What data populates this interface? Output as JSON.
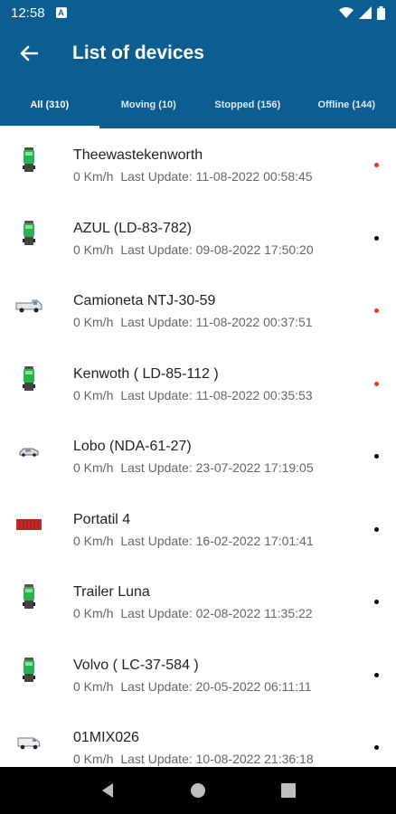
{
  "status_bar": {
    "time": "12:58",
    "notification_badge": "A"
  },
  "app_bar": {
    "title": "List of devices",
    "back_icon": "arrow-left-icon"
  },
  "tabs": [
    {
      "label": "All (310)",
      "active": true
    },
    {
      "label": "Moving (10)",
      "active": false
    },
    {
      "label": "Stopped (156)",
      "active": false
    },
    {
      "label": "Offline (144)",
      "active": false
    }
  ],
  "devices": [
    {
      "name": " Theewastekenworth",
      "speed": "0 Km/h",
      "last_update": "Last Update: 11-08-2022 00:58:45",
      "icon": "truck-icon",
      "status_color": "#e53935"
    },
    {
      "name": "AZUL (LD-83-782)",
      "speed": "0 Km/h",
      "last_update": "Last Update: 09-08-2022 17:50:20",
      "icon": "truck-icon",
      "status_color": "#000000"
    },
    {
      "name": "Camioneta NTJ-30-59",
      "speed": "0 Km/h",
      "last_update": "Last Update: 11-08-2022 00:37:51",
      "icon": "van-icon",
      "status_color": "#e53935"
    },
    {
      "name": "Kenwoth ( LD-85-112 )",
      "speed": "0 Km/h",
      "last_update": "Last Update: 11-08-2022 00:35:53",
      "icon": "truck-icon",
      "status_color": "#e53935"
    },
    {
      "name": "Lobo (NDA-61-27)",
      "speed": "0 Km/h",
      "last_update": "Last Update: 23-07-2022 17:19:05",
      "icon": "car-icon",
      "status_color": "#000000"
    },
    {
      "name": "Portatil 4",
      "speed": "0 Km/h",
      "last_update": "Last Update: 16-02-2022 17:01:41",
      "icon": "container-icon",
      "status_color": "#000000"
    },
    {
      "name": "Trailer Luna",
      "speed": "0 Km/h",
      "last_update": "Last Update: 02-08-2022 11:35:22",
      "icon": "truck-icon",
      "status_color": "#000000"
    },
    {
      "name": "Volvo ( LC-37-584 )",
      "speed": "0 Km/h",
      "last_update": "Last Update: 20-05-2022 06:11:11",
      "icon": "truck-icon",
      "status_color": "#000000"
    },
    {
      "name": "01MIX026",
      "speed": "0 Km/h",
      "last_update": "Last Update: 10-08-2022 21:36:18",
      "icon": "van-icon",
      "status_color": "#000000"
    }
  ],
  "colors": {
    "primary": "#0b5d92",
    "truck_green": "#2bb24c",
    "offline_red": "#e53935"
  }
}
